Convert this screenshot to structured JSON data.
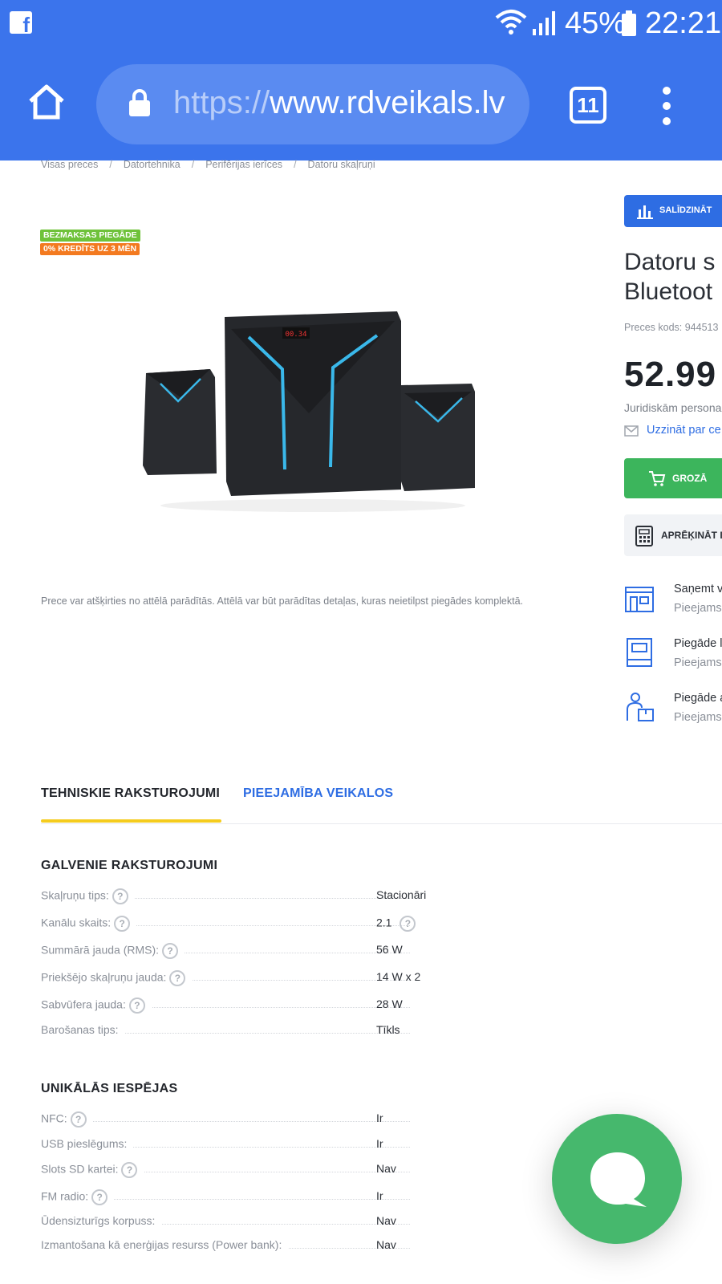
{
  "status_bar": {
    "battery": "45%",
    "time": "22:21"
  },
  "browser": {
    "url_scheme": "https://",
    "url_host": "www.rdveikals.lv",
    "tab_count": "11"
  },
  "breadcrumb": [
    "Visas preces",
    "Datortehnika",
    "Perifērijas ierīces",
    "Datoru skaļruņi"
  ],
  "badges": {
    "free_delivery": "BEZMAKSAS PIEGĀDE",
    "credit": "0% KREDĪTS UZ 3 MĒN"
  },
  "product": {
    "disclaimer": "Prece var atšķirties no attēlā parādītās. Attēlā var būt parādītas detaļas, kuras neietilpst piegādes komplektā.",
    "compare_label": "SALĪDZINĀT",
    "title_line1": "Datoru s",
    "title_line2": "Bluetoot",
    "code": "Preces kods: 944513",
    "price": "52.99",
    "legal_note": "Juridiskām persona",
    "price_alert": "Uzzināt par ce",
    "cart_label": "GROZĀ",
    "calc_label": "APRĒĶINĀT I"
  },
  "delivery_options": [
    {
      "title": "Saņemt v",
      "sub": "Pieejams"
    },
    {
      "title": "Piegāde l",
      "sub": "Pieejams"
    },
    {
      "title": "Piegāde a",
      "sub": "Pieejams"
    }
  ],
  "tabs": {
    "specs": "TEHNISKIE RAKSTUROJUMI",
    "availability": "PIEEJAMĪBA VEIKALOS"
  },
  "sections": {
    "main": {
      "title": "GALVENIE RAKSTUROJUMI",
      "rows": [
        {
          "label": "Skaļruņu tips:",
          "value": "Stacionāri"
        },
        {
          "label": "Kanālu skaits:",
          "value": "2.1"
        },
        {
          "label": "Summārā jauda (RMS):",
          "value": "56 W"
        },
        {
          "label": "Priekšējo skaļruņu jauda:",
          "value": "14 W x 2"
        },
        {
          "label": "Sabvūfera jauda:",
          "value": "28 W"
        },
        {
          "label": "Barošanas tips:",
          "value": "Tīkls"
        }
      ]
    },
    "unique": {
      "title": "UNIKĀLĀS IESPĒJAS",
      "rows": [
        {
          "label": "NFC:",
          "value": "Ir"
        },
        {
          "label": "USB pieslēgums:",
          "value": "Ir"
        },
        {
          "label": "Slots SD kartei:",
          "value": "Nav"
        },
        {
          "label": "FM radio:",
          "value": "Ir"
        },
        {
          "label": "Ūdensizturīgs korpuss:",
          "value": "Nav"
        },
        {
          "label": "Izmantošana kā enerģijas resurss (Power bank):",
          "value": "Nav"
        }
      ]
    }
  },
  "help_glyph": "?",
  "colors": {
    "browser_bar": "#3b74ec",
    "accent_blue": "#2e6de3",
    "cart_green": "#3cb55c",
    "tab_underline": "#f5cc1e",
    "badge_green": "#6fc23a",
    "badge_orange": "#f37a20"
  }
}
